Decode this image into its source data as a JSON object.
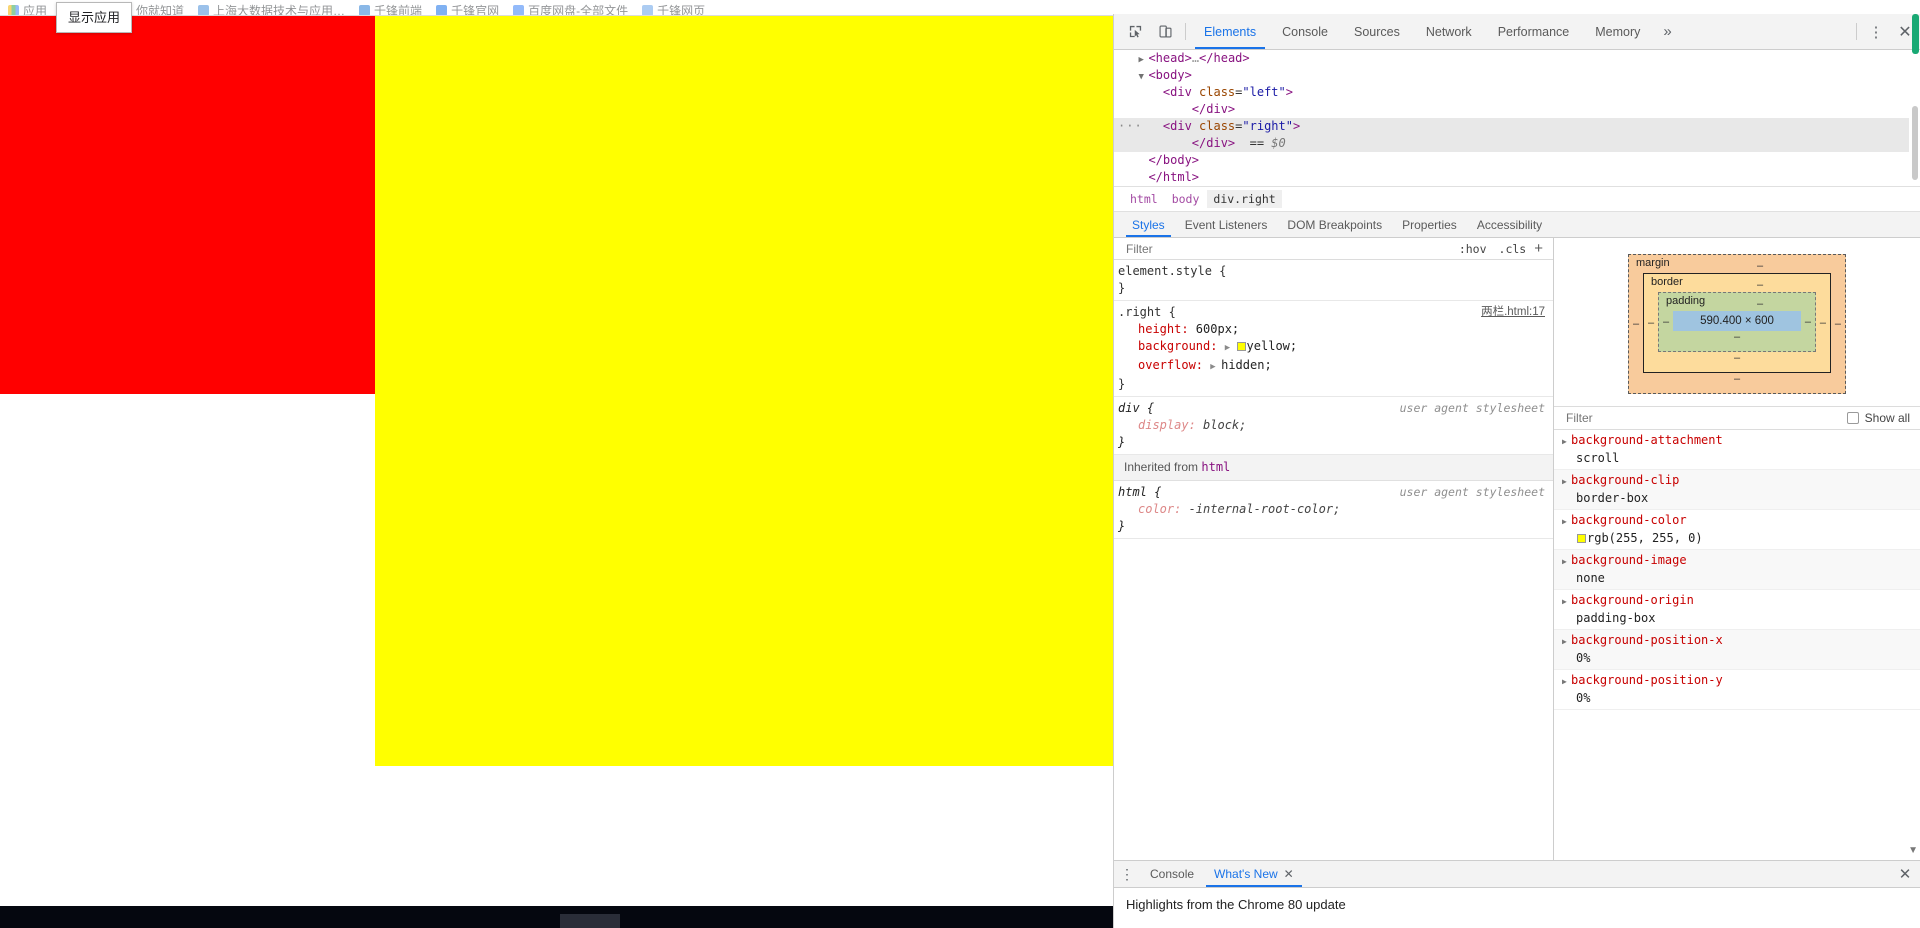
{
  "browser": {
    "bookmarks": [
      {
        "label": "应用",
        "color": "#f5b400"
      },
      {
        "label": "百度一下，你就知道",
        "color": "#2932e1"
      },
      {
        "label": "上海大数据技术与应用…",
        "color": "#4a90d9"
      },
      {
        "label": "千锋前端",
        "color": "#2b7fd4"
      },
      {
        "label": "千锋官网",
        "color": "#1a73e8"
      },
      {
        "label": "百度网盘-全部文件",
        "color": "#3b82f6"
      },
      {
        "label": "千锋网页",
        "color": "#6aa3e8"
      }
    ],
    "tooltip": "显示应用",
    "page": {
      "left_div_color": "#ff0000",
      "right_div_color": "#ffff00"
    }
  },
  "devtools": {
    "toolbar": {
      "inspect_icon": "inspect-cursor-icon",
      "device_icon": "device-toolbar-icon",
      "tabs": [
        {
          "label": "Elements",
          "active": true
        },
        {
          "label": "Console",
          "active": false
        },
        {
          "label": "Sources",
          "active": false
        },
        {
          "label": "Network",
          "active": false
        },
        {
          "label": "Performance",
          "active": false
        },
        {
          "label": "Memory",
          "active": false
        }
      ],
      "more_tabs": "»",
      "menu_icon": "⋮",
      "close_icon": "✕"
    },
    "dom_tree": [
      {
        "indent": 1,
        "triangle": "▶",
        "segments": [
          {
            "t": "<head>",
            "c": "tw"
          },
          {
            "t": "…",
            "c": "dim"
          },
          {
            "t": "</head>",
            "c": "tw"
          }
        ],
        "selected": false,
        "ellipsis": false
      },
      {
        "indent": 1,
        "triangle": "▼",
        "segments": [
          {
            "t": "<body>",
            "c": "tw"
          }
        ],
        "selected": false,
        "ellipsis": false
      },
      {
        "indent": 2,
        "triangle": "",
        "segments": [
          {
            "t": "<div ",
            "c": "tw"
          },
          {
            "t": "class",
            "c": "at"
          },
          {
            "t": "=",
            "c": "pk"
          },
          {
            "t": "\"left\"",
            "c": "av"
          },
          {
            "t": ">",
            "c": "tw"
          }
        ],
        "selected": false,
        "ellipsis": false
      },
      {
        "indent": 4,
        "triangle": "",
        "segments": [
          {
            "t": "</div>",
            "c": "tw"
          }
        ],
        "selected": false,
        "ellipsis": false
      },
      {
        "indent": 2,
        "triangle": "",
        "segments": [
          {
            "t": "<div ",
            "c": "tw"
          },
          {
            "t": "class",
            "c": "at"
          },
          {
            "t": "=",
            "c": "pk"
          },
          {
            "t": "\"right\"",
            "c": "av"
          },
          {
            "t": ">",
            "c": "tw"
          }
        ],
        "selected": true,
        "ellipsis": true
      },
      {
        "indent": 4,
        "triangle": "",
        "segments": [
          {
            "t": "</div>",
            "c": "tw"
          },
          {
            "t": "  == ",
            "c": "pk"
          },
          {
            "t": "$0",
            "c": "dollar"
          }
        ],
        "selected": true,
        "ellipsis": false
      },
      {
        "indent": 1,
        "triangle": "",
        "segments": [
          {
            "t": "</body>",
            "c": "tw"
          }
        ],
        "selected": false,
        "ellipsis": false
      },
      {
        "indent": 1,
        "triangle": "",
        "segments": [
          {
            "t": "</html>",
            "c": "tw"
          }
        ],
        "selected": false,
        "ellipsis": false
      }
    ],
    "breadcrumb": [
      {
        "label": "html",
        "active": false
      },
      {
        "label": "body",
        "active": false
      },
      {
        "label": "div.right",
        "active": true
      }
    ],
    "sidebar_tabs": [
      {
        "label": "Styles",
        "active": true
      },
      {
        "label": "Event Listeners",
        "active": false
      },
      {
        "label": "DOM Breakpoints",
        "active": false
      },
      {
        "label": "Properties",
        "active": false
      },
      {
        "label": "Accessibility",
        "active": false
      }
    ],
    "styles_filter": {
      "placeholder": "Filter",
      "value": "",
      "hov": ":hov",
      "cls": ".cls",
      "plus": "+"
    },
    "rules": [
      {
        "selector": "element.style {",
        "close": "}",
        "origin": "",
        "origin_is_link": false,
        "ua": false,
        "declarations": []
      },
      {
        "selector": ".right {",
        "close": "}",
        "origin": "两栏.html:17",
        "origin_is_link": true,
        "ua": false,
        "declarations": [
          {
            "name": "height",
            "value": "600px",
            "arrow": false,
            "swatch": null
          },
          {
            "name": "background",
            "value": "yellow",
            "arrow": true,
            "swatch": "#ffff00"
          },
          {
            "name": "overflow",
            "value": "hidden",
            "arrow": true,
            "swatch": null
          }
        ]
      },
      {
        "selector": "div {",
        "close": "}",
        "origin": "user agent stylesheet",
        "origin_is_link": false,
        "ua": true,
        "declarations": [
          {
            "name": "display",
            "value": "block",
            "arrow": false,
            "swatch": null
          }
        ]
      }
    ],
    "inherited_header": "Inherited from ",
    "inherited_from": "html",
    "inherited_rules": [
      {
        "selector": "html {",
        "close": "}",
        "origin": "user agent stylesheet",
        "origin_is_link": false,
        "ua": true,
        "declarations": [
          {
            "name": "color",
            "value": "-internal-root-color;",
            "arrow": false,
            "swatch": null
          }
        ]
      }
    ],
    "box_model": {
      "margin_label": "margin",
      "border_label": "border",
      "padding_label": "padding",
      "content_size": "590.400 × 600",
      "dash": "–"
    },
    "computed_filter": {
      "placeholder": "Filter",
      "value": "",
      "show_all_label": "Show all",
      "show_all_checked": false
    },
    "computed_properties": [
      {
        "name": "background-attachment",
        "value": "scroll",
        "swatch": null
      },
      {
        "name": "background-clip",
        "value": "border-box",
        "swatch": null
      },
      {
        "name": "background-color",
        "value": "rgb(255, 255, 0)",
        "swatch": "#ffff00"
      },
      {
        "name": "background-image",
        "value": "none",
        "swatch": null
      },
      {
        "name": "background-origin",
        "value": "padding-box",
        "swatch": null
      },
      {
        "name": "background-position-x",
        "value": "0%",
        "swatch": null
      },
      {
        "name": "background-position-y",
        "value": "0%",
        "swatch": null
      }
    ],
    "drawer": {
      "menu_icon": "⋮",
      "tabs": [
        {
          "label": "Console",
          "active": false,
          "closable": false
        },
        {
          "label": "What's New",
          "active": true,
          "closable": true
        }
      ],
      "close_icon": "✕",
      "content": "Highlights from the Chrome 80 update"
    }
  }
}
